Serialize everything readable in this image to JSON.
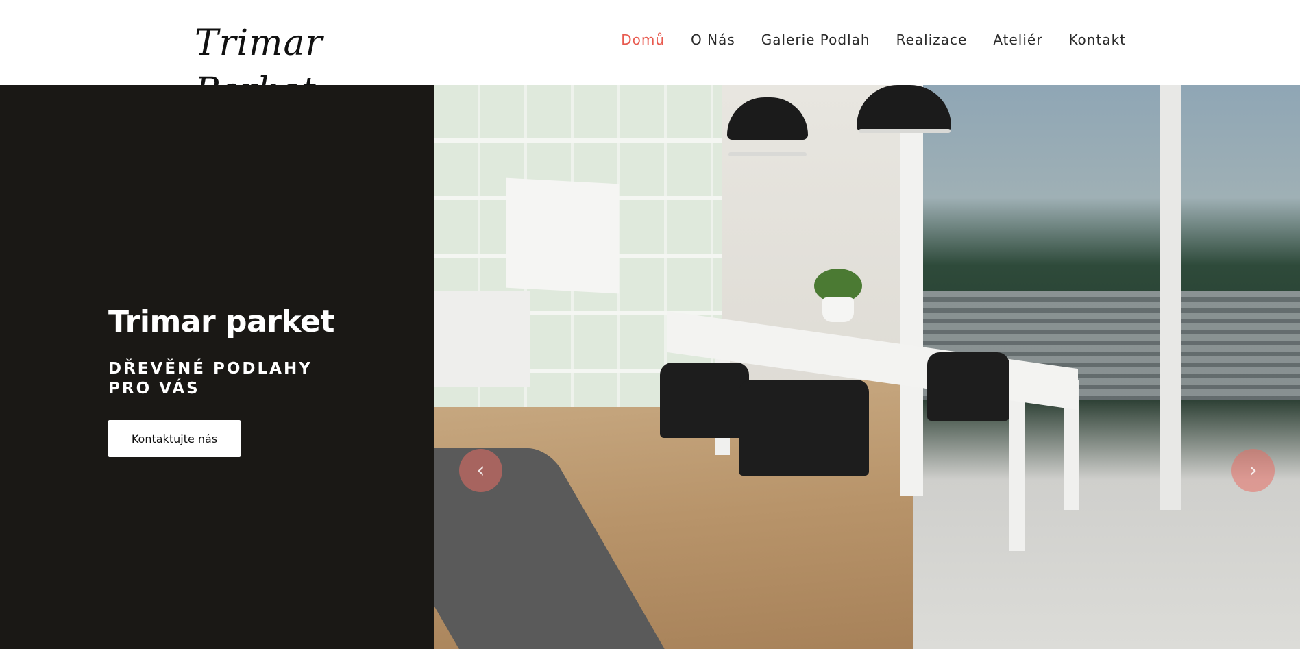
{
  "header": {
    "logo_text": "Trimar Parket",
    "nav": [
      {
        "label": "Domů",
        "active": true
      },
      {
        "label": "O Nás",
        "active": false
      },
      {
        "label": "Galerie Podlah",
        "active": false
      },
      {
        "label": "Realizace",
        "active": false
      },
      {
        "label": "Ateliér",
        "active": false
      },
      {
        "label": "Kontakt",
        "active": false
      }
    ]
  },
  "hero": {
    "title": "Trimar parket",
    "subtitle_line1": "DŘEVĚNÉ PODLAHY",
    "subtitle_line2": "PRO VÁS",
    "button_label": "Kontaktujte nás",
    "prev_icon": "‹",
    "next_icon": "›"
  },
  "colors": {
    "accent": "#e85a4f",
    "hero_dark": "#1a1815",
    "nav_text": "#2a2a2a"
  }
}
